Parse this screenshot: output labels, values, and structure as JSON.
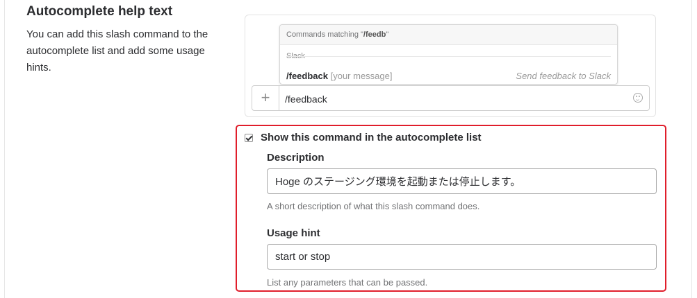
{
  "section": {
    "title": "Autocomplete help text",
    "description": "You can add this slash command to the autocomplete list and add some usage hints."
  },
  "preview": {
    "matching_prefix": "Commands matching \"",
    "matching_query": "/feedb",
    "matching_suffix": "\"",
    "group": "Slack",
    "command": "/feedback",
    "hint": "[your message]",
    "command_desc": "Send feedback to Slack",
    "plus_symbol": "+",
    "input_value": "/feedback",
    "icons": {
      "plus": "plus-icon",
      "emoji": "emoji-icon"
    }
  },
  "settings": {
    "checkbox_label": "Show this command in the autocomplete list",
    "checkbox_checked": true,
    "description_label": "Description",
    "description_value": "Hoge のステージング環境を起動または停止します。",
    "description_help": "A short description of what this slash command does.",
    "usage_label": "Usage hint",
    "usage_value": "start or stop",
    "usage_help": "List any parameters that can be passed."
  },
  "colors": {
    "highlight": "#e01e2b",
    "text": "#2c2d30",
    "muted": "#717274"
  }
}
